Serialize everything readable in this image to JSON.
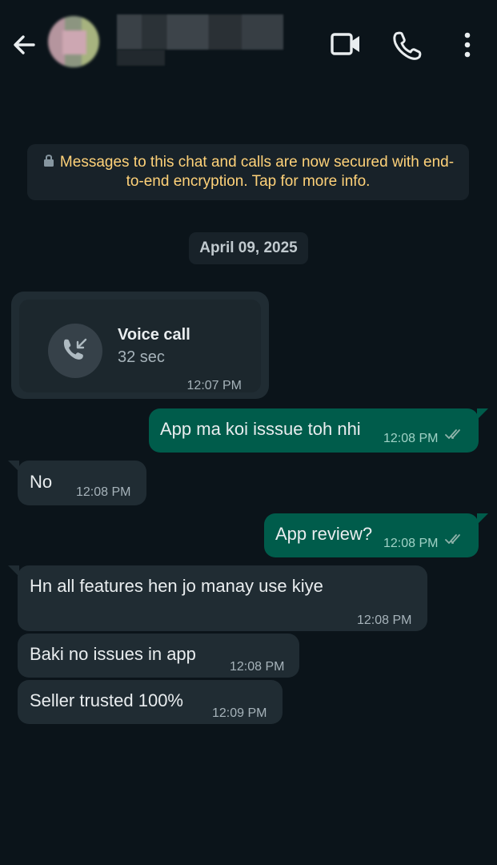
{
  "header": {
    "contact_name": "",
    "contact_status": "",
    "icons": {
      "back": "arrow-left-icon",
      "video": "video-camera-icon",
      "call": "phone-icon",
      "menu": "more-vertical-icon"
    }
  },
  "chat": {
    "encryption_notice": "Messages to this chat and calls are now secured with end-to-end encryption. Tap for more info.",
    "date_chip": "April 09, 2025",
    "call": {
      "title": "Voice call",
      "duration": "32 sec",
      "time": "12:07 PM",
      "icon": "incoming-call-icon"
    },
    "messages": [
      {
        "direction": "out",
        "text": "App ma koi isssue toh nhi",
        "time": "12:08 PM",
        "status": "read"
      },
      {
        "direction": "in",
        "text": "No",
        "time": "12:08 PM"
      },
      {
        "direction": "out",
        "text": "App review?",
        "time": "12:08 PM",
        "status": "read"
      },
      {
        "direction": "in",
        "text": "Hn all features hen jo manay use kiye",
        "time": "12:08 PM"
      },
      {
        "direction": "in",
        "text": "Baki no issues in app",
        "time": "12:08 PM"
      },
      {
        "direction": "in",
        "text": "Seller trusted 100%",
        "time": "12:09 PM"
      }
    ]
  },
  "colors": {
    "background": "#0b141a",
    "incoming_bubble": "#202c33",
    "outgoing_bubble": "#005c4b",
    "notice_text": "#ffd279",
    "read_ticks": "#8696a0"
  }
}
